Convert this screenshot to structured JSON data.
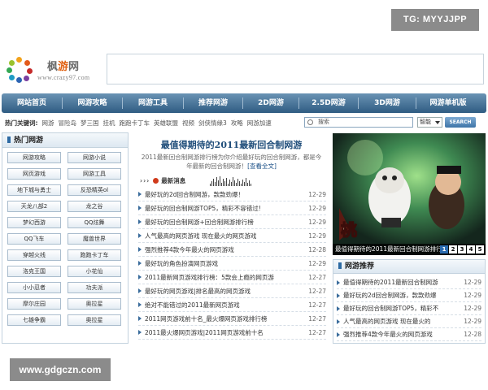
{
  "watermarks": {
    "top": "TG: MYYJJPP",
    "bottom": "www.gdgczn.com"
  },
  "logo": {
    "brand_a": "枫",
    "brand_b": "游",
    "brand_c": "网",
    "url": "www.crazy97.com"
  },
  "nav": {
    "items": [
      "网站首页",
      "网游攻略",
      "网游工具",
      "推荐网游",
      "2D网游",
      "2.5D网游",
      "3D网游",
      "网游单机版"
    ]
  },
  "keywords": {
    "label": "热门关键词:",
    "items": [
      "网游",
      "冒险岛",
      "梦三国",
      "挂机",
      "跑跑卡丁车",
      "英雄联盟",
      "视频",
      "剑侠情缘3",
      "攻略",
      "网游加速"
    ]
  },
  "search": {
    "placeholder": "搜索",
    "select_value": "智能",
    "button_label": "SEARCH"
  },
  "hot_games": {
    "title": "热门网游",
    "items": [
      "网游攻略",
      "网游小说",
      "网页游戏",
      "网游工具",
      "地下城与勇士",
      "反恐精英ol",
      "天龙八部2",
      "龙之谷",
      "梦幻西游",
      "QQ炫舞",
      "QQ飞车",
      "魔兽世界",
      "穿越火线",
      "跑跑卡丁车",
      "洛克王国",
      "小花仙",
      "小小忍者",
      "功夫派",
      "摩尔庄园",
      "奥拉星",
      "七雄争霸",
      "奥拉星"
    ]
  },
  "featured": {
    "title": "最值得期待的2011最新回合制网游",
    "desc": "2011最新回合制网游排行榜为你介绍最好玩的回合制网游，都是今年最新的回合制网游！",
    "more": "[查看全文]"
  },
  "news": {
    "label": "最新消息",
    "items": [
      {
        "title": "最好玩的2d回合制网游，款款劲爆！",
        "date": "12-29"
      },
      {
        "title": "最好玩的回合制网游TOP5，精彩不容错过!",
        "date": "12-29"
      },
      {
        "title": "最好玩的回合制网游+回合制网游排行榜",
        "date": "12-29"
      },
      {
        "title": "人气最高的网页游戏 现在最火的网页游戏",
        "date": "12-29"
      },
      {
        "title": "强烈推荐4款今年最火的网页游戏",
        "date": "12-28"
      },
      {
        "title": "最好玩的角色扮演网页游戏",
        "date": "12-29"
      },
      {
        "title": "2011最新网页游戏排行榜：5款会上瘾的网页游",
        "date": "12-27"
      },
      {
        "title": "最好玩的网页游戏|排名最高的网页游戏",
        "date": "12-27"
      },
      {
        "title": "绝对不能错过的2011最新网页游戏",
        "date": "12-27"
      },
      {
        "title": "2011网页游戏前十名_最火爆网页游戏排行榜",
        "date": "12-27"
      },
      {
        "title": "2011最火爆网页游戏|2011网页游戏前十名",
        "date": "12-27"
      }
    ]
  },
  "slideshow": {
    "caption": "最值得期待的2011最新回合制网游排行",
    "numbers": [
      "1",
      "2",
      "3",
      "4",
      "5"
    ],
    "active": "1"
  },
  "recommend": {
    "title": "网游推荐",
    "items": [
      {
        "title": "最值得期待的2011最新回合制网游",
        "date": "12-29"
      },
      {
        "title": "最好玩的2d回合制网游，款款劲爆",
        "date": "12-29"
      },
      {
        "title": "最好玩的回合制网游TOP5，精彩不",
        "date": "12-29"
      },
      {
        "title": "人气最高的网页游戏 现在最火的",
        "date": "12-29"
      },
      {
        "title": "强烈推荐4款今年最火的网页游戏",
        "date": "12-28"
      }
    ]
  },
  "colors": {
    "nav_top": "#6a93b4",
    "nav_bottom": "#2f5c82",
    "title_blue": "#1f4d7a"
  }
}
